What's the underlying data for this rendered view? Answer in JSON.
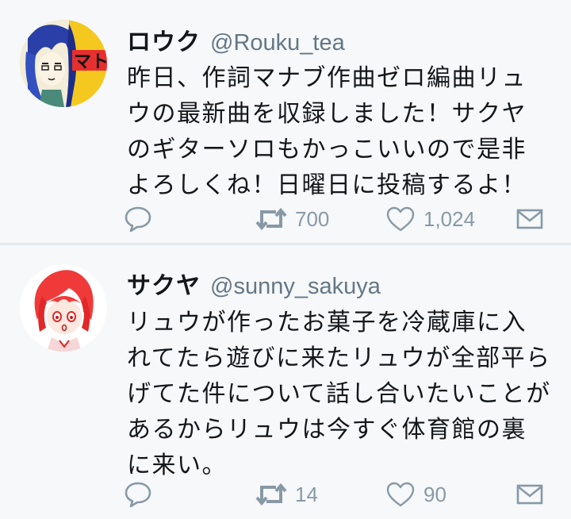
{
  "colors": {
    "background": "#f6f8fa",
    "separator": "#e1e8ed",
    "text_primary": "#14171a",
    "text_secondary": "#657786",
    "icon": "#8899a6"
  },
  "tweets": [
    {
      "display_name": "ロウク",
      "handle": "@Rouku_tea",
      "avatar_icon": "anime-avatar-blue-hair",
      "text": "昨日、作詞マナブ作曲ゼロ編曲リュウの最新曲を収録しました！サクヤのギターソロもかっこいいので是非よろしくね！日曜日に投稿するよ！",
      "retweets": "700",
      "likes": "1,024"
    },
    {
      "display_name": "サクヤ",
      "handle": "@sunny_sakuya",
      "avatar_icon": "anime-avatar-red-hair",
      "text": "リュウが作ったお菓子を冷蔵庫に入れてたら遊びに来たリュウが全部平らげてた件について話し合いたいことがあるからリュウは今すぐ体育館の裏に来い。",
      "retweets": "14",
      "likes": "90"
    }
  ]
}
